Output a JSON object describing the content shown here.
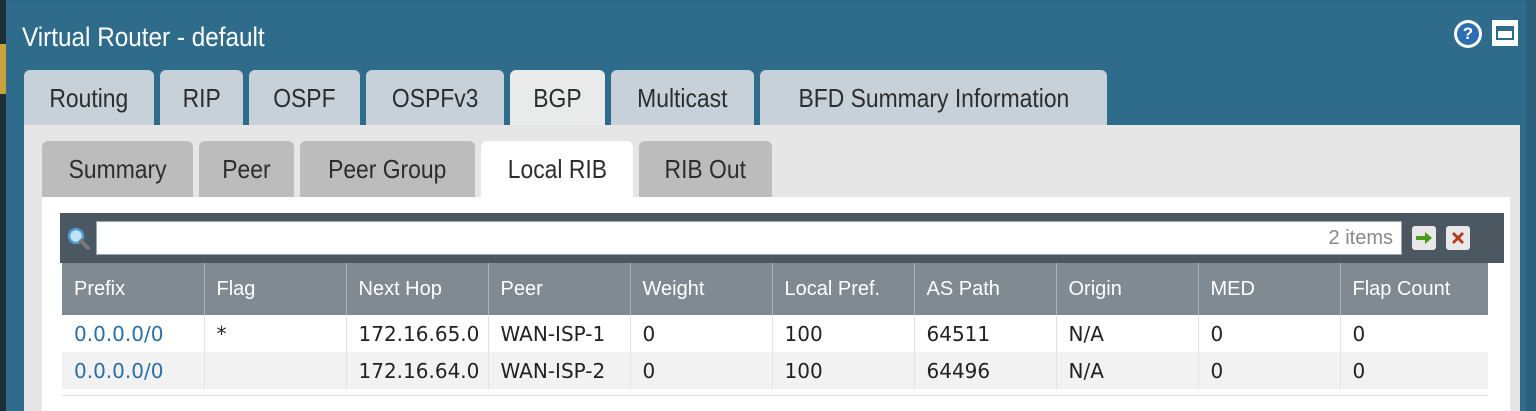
{
  "window": {
    "title": "Virtual Router - default"
  },
  "icons": {
    "help": "help-icon",
    "minimize": "minimize-icon",
    "search": "magnifier-icon",
    "apply": "arrow-right-icon",
    "clear": "close-x-icon"
  },
  "colors": {
    "title_bar": "#2f6b8b",
    "tab_inactive": "#c6d1d9",
    "table_header": "#7f8a92",
    "link": "#2a6fa8",
    "apply": "#4a9a1e",
    "clear": "#b33a1a"
  },
  "top_tabs": [
    {
      "label": "Routing"
    },
    {
      "label": "RIP"
    },
    {
      "label": "OSPF"
    },
    {
      "label": "OSPFv3"
    },
    {
      "label": "BGP"
    },
    {
      "label": "Multicast"
    },
    {
      "label": "BFD Summary Information"
    }
  ],
  "top_tabs_active": "BGP",
  "sub_tabs": [
    {
      "label": "Summary"
    },
    {
      "label": "Peer"
    },
    {
      "label": "Peer Group"
    },
    {
      "label": "Local RIB"
    },
    {
      "label": "RIB Out"
    }
  ],
  "sub_tabs_active": "Local RIB",
  "search": {
    "value": "",
    "placeholder": "2 items"
  },
  "table": {
    "columns": [
      "Prefix",
      "Flag",
      "Next Hop",
      "Peer",
      "Weight",
      "Local Pref.",
      "AS Path",
      "Origin",
      "MED",
      "Flap Count"
    ],
    "rows": [
      [
        "0.0.0.0/0",
        "*",
        "172.16.65.0",
        "WAN-ISP-1",
        "0",
        "100",
        "64511",
        "N/A",
        "0",
        "0"
      ],
      [
        "0.0.0.0/0",
        "",
        "172.16.64.0",
        "WAN-ISP-2",
        "0",
        "100",
        "64496",
        "N/A",
        "0",
        "0"
      ]
    ]
  }
}
